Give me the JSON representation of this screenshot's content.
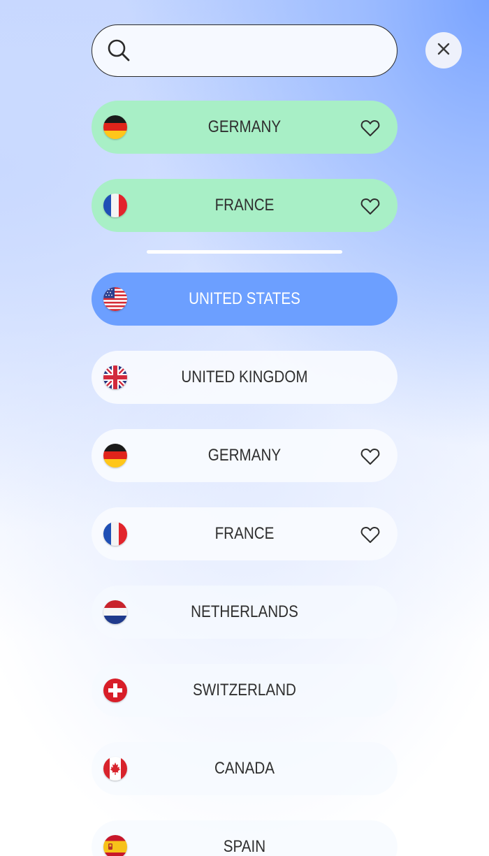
{
  "search": {
    "value": "",
    "placeholder": ""
  },
  "favorites": [
    {
      "name": "GERMANY",
      "flag": "germany-flag",
      "favorite": true
    },
    {
      "name": "FRANCE",
      "flag": "france-flag",
      "favorite": true
    }
  ],
  "countries": [
    {
      "name": "UNITED STATES",
      "flag": "united-states-flag",
      "selected": true,
      "favorite": false
    },
    {
      "name": "UNITED KINGDOM",
      "flag": "united-kingdom-flag",
      "selected": false,
      "favorite": false
    },
    {
      "name": "GERMANY",
      "flag": "germany-flag",
      "selected": false,
      "favorite": true
    },
    {
      "name": "FRANCE",
      "flag": "france-flag",
      "selected": false,
      "favorite": true
    },
    {
      "name": "NETHERLANDS",
      "flag": "netherlands-flag",
      "selected": false,
      "favorite": false
    },
    {
      "name": "SWITZERLAND",
      "flag": "switzerland-flag",
      "selected": false,
      "favorite": false
    },
    {
      "name": "CANADA",
      "flag": "canada-flag",
      "selected": false,
      "favorite": false
    },
    {
      "name": "SPAIN",
      "flag": "spain-flag",
      "selected": false,
      "favorite": false
    }
  ],
  "colors": {
    "favorite_row": "#a8efc6",
    "selected_row": "#6c9fff",
    "row": "#f8fbff",
    "text": "#2f2f2f",
    "selected_text": "#ffffff"
  }
}
